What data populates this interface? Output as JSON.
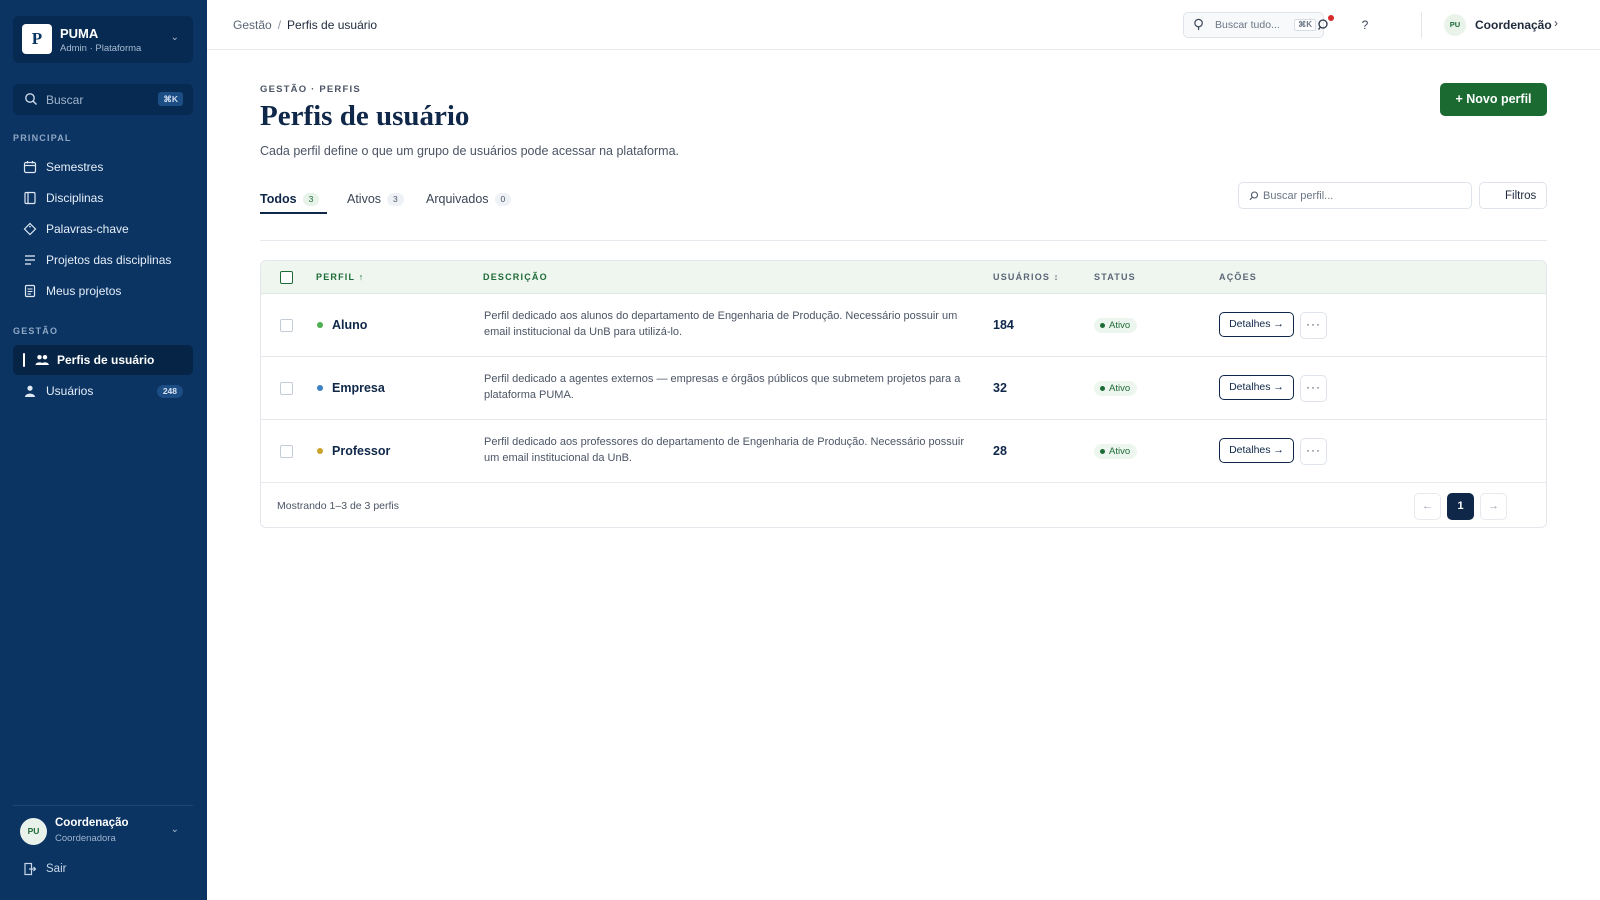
{
  "sidebar": {
    "brand": {
      "logo": "P",
      "name": "PUMA",
      "subtitle": "Admin · Plataforma"
    },
    "search": {
      "placeholder": "Buscar",
      "shortcut": "⌘K"
    },
    "sections": [
      {
        "label": "PRINCIPAL",
        "items": [
          {
            "label": "Semestres",
            "icon": "calendar-icon"
          },
          {
            "label": "Disciplinas",
            "icon": "book-icon"
          },
          {
            "label": "Palavras-chave",
            "icon": "tag-icon"
          },
          {
            "label": "Projetos das disciplinas",
            "icon": "list-icon"
          },
          {
            "label": "Meus projetos",
            "icon": "document-icon"
          }
        ]
      },
      {
        "label": "GESTÃO",
        "items": [
          {
            "label": "Perfis de usuário",
            "icon": "users-icon",
            "active": true
          },
          {
            "label": "Usuários",
            "icon": "user-icon",
            "badge": "248"
          }
        ]
      }
    ],
    "user": {
      "initials": "PU",
      "name": "Coordenação",
      "role": "Coordenadora"
    },
    "logout": "Sair"
  },
  "topbar": {
    "breadcrumb": [
      "Gestão",
      "Perfis de usuário"
    ],
    "search": {
      "placeholder": "Buscar tudo...",
      "shortcut": "⌘K"
    },
    "help": "?",
    "user": {
      "initials": "PU",
      "name": "Coordenação"
    }
  },
  "page": {
    "eyebrow": "GESTÃO · PERFIS",
    "title": "Perfis de usuário",
    "subtitle": "Cada perfil define o que um grupo de usuários pode acessar na plataforma.",
    "new_button": "+ Novo perfil",
    "tabs": [
      {
        "label": "Todos",
        "count": "3",
        "active": true
      },
      {
        "label": "Ativos",
        "count": "3"
      },
      {
        "label": "Arquivados",
        "count": "0"
      }
    ],
    "filter_search_placeholder": "Buscar perfil...",
    "filter_button": "Filtros"
  },
  "table": {
    "headers": {
      "profile": "PERFIL ↑",
      "description": "DESCRIÇÃO",
      "users": "USUÁRIOS ↕",
      "status": "STATUS",
      "actions": "AÇÕES"
    },
    "rows": [
      {
        "name": "Aluno",
        "dot_color": "#4caf50",
        "description": "Perfil dedicado aos alunos do departamento de Engenharia de Produção. Necessário possuir um email institucional da UnB para utilizá-lo.",
        "users": "184",
        "status": "Ativo",
        "details": "Detalhes →",
        "more": "···"
      },
      {
        "name": "Empresa",
        "dot_color": "#3b82c4",
        "description": "Perfil dedicado a agentes externos — empresas e órgãos públicos que submetem projetos para a plataforma PUMA.",
        "users": "32",
        "status": "Ativo",
        "details": "Detalhes →",
        "more": "···"
      },
      {
        "name": "Professor",
        "dot_color": "#c9a227",
        "description": "Perfil dedicado aos professores do departamento de Engenharia de Produção. Necessário possuir um email institucional da UnB.",
        "users": "28",
        "status": "Ativo",
        "details": "Detalhes →",
        "more": "···"
      }
    ],
    "footer": {
      "info": "Mostrando 1–3 de 3 perfis",
      "prev": "←",
      "page": "1",
      "next": "→"
    }
  }
}
